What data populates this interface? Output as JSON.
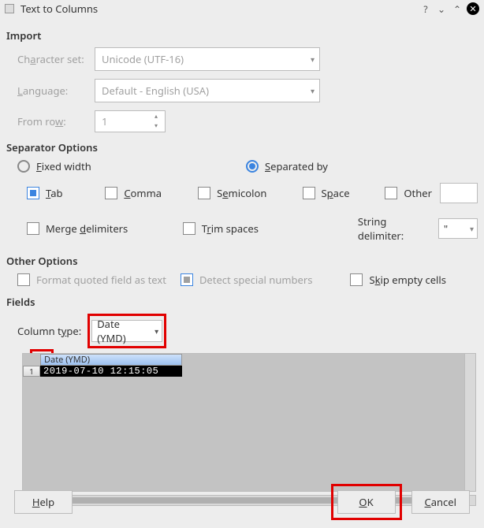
{
  "titlebar": {
    "title": "Text to Columns"
  },
  "import": {
    "heading": "Import",
    "charset_label_pre": "Ch",
    "charset_label_hot": "a",
    "charset_label_post": "racter set:",
    "charset_value": "Unicode (UTF-16)",
    "language_label_hot": "L",
    "language_label_post": "anguage:",
    "language_value": "Default - English (USA)",
    "fromrow_label_pre": "From ro",
    "fromrow_label_hot": "w",
    "fromrow_label_post": ":",
    "fromrow_value": "1"
  },
  "separator": {
    "heading": "Separator Options",
    "fixed_hot": "F",
    "fixed_post": "ixed width",
    "sepby_hot": "S",
    "sepby_post": "eparated by",
    "tab_hot": "T",
    "tab_post": "ab",
    "comma_hot": "C",
    "comma_post": "omma",
    "semicolon_pre": "S",
    "semicolon_hot": "e",
    "semicolon_post": "micolon",
    "space_pre": "S",
    "space_hot": "p",
    "space_post": "ace",
    "other": "Other",
    "merge_pre": "Merge ",
    "merge_hot": "d",
    "merge_post": "elimiters",
    "trim_pre": "T",
    "trim_hot": "r",
    "trim_post": "im spaces",
    "stringdelim_label": "String delimiter:",
    "stringdelim_value": "\""
  },
  "other_options": {
    "heading": "Other Options",
    "format_pre": "F",
    "format_hot": "o",
    "format_post": "rmat quoted field as text",
    "detect_pre": "Detect special ",
    "detect_hot": "n",
    "detect_post": "umbers",
    "skip_pre": "S",
    "skip_hot": "k",
    "skip_post": "ip empty cells"
  },
  "fields": {
    "heading": "Fields",
    "coltype_label_pre": "Column t",
    "coltype_label_hot": "y",
    "coltype_label_post": "pe:",
    "coltype_value": "Date (YMD)",
    "preview_header": "Date (YMD)",
    "preview_rownum": "1",
    "preview_cell": "2019-07-10 12:15:05"
  },
  "buttons": {
    "help_hot": "H",
    "help_post": "elp",
    "ok_hot": "O",
    "ok_post": "K",
    "cancel_hot": "C",
    "cancel_post": "ancel"
  }
}
